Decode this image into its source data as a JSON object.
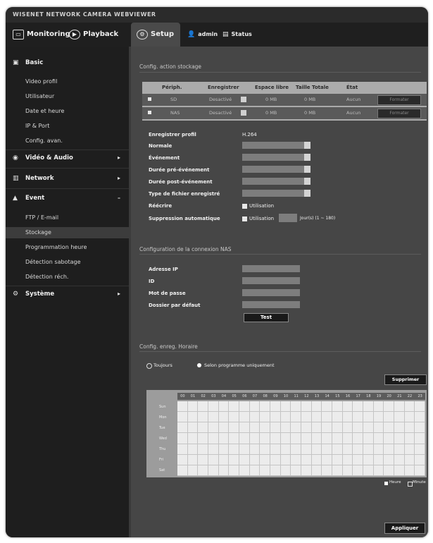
{
  "window": {
    "title": "WISENET NETWORK CAMERA WEBVIEWER"
  },
  "topnav": {
    "monitoring": "Monitoring",
    "playback": "Playback",
    "setup": "Setup",
    "user": "admin",
    "status": "Status"
  },
  "sidebar": {
    "basic": "Basic",
    "basic_items": [
      "Video profil",
      "Utilisateur",
      "Date et heure",
      "IP & Port",
      "Config. avan."
    ],
    "video_audio": "Vidéo & Audio",
    "network": "Network",
    "event": "Event",
    "event_items": [
      "FTP / E-mail",
      "Stockage",
      "Programmation heure",
      "Détection sabotage",
      "Détection réch."
    ],
    "system": "Système"
  },
  "storage": {
    "section_title": "Config. action stockage",
    "columns": [
      "Périph.",
      "Enregistrer",
      "Espace libre",
      "Taille Totale",
      "État"
    ],
    "rows": [
      {
        "device": "SD",
        "record": "Desactivé",
        "free": "0 MB",
        "total": "0 MB",
        "state": "Aucun",
        "action": "Formater"
      },
      {
        "device": "NAS",
        "record": "Desactivé",
        "free": "0 MB",
        "total": "0 MB",
        "state": "Aucun",
        "action": "Formater"
      }
    ]
  },
  "form": {
    "profile_label": "Enregistrer profil",
    "profile_value": "H.264",
    "normal_label": "Normale",
    "event_label": "Événement",
    "pre_event_label": "Durée pré-événement",
    "post_event_label": "Durée post-événement",
    "file_type_label": "Type de fichier enregistré",
    "overwrite_label": "Réécrire",
    "overwrite_check": "Utilisation",
    "auto_delete_label": "Suppression automatique",
    "auto_delete_check": "Utilisation",
    "auto_delete_range": "Jour(s) (1 ~ 180)"
  },
  "nas": {
    "section_title": "Configuration de la connexion NAS",
    "ip_label": "Adresse IP",
    "id_label": "ID",
    "password_label": "Mot de passe",
    "folder_label": "Dossier par défaut",
    "test_button": "Test"
  },
  "schedule": {
    "section_title": "Config. enreg. Horaire",
    "option_always": "Toujours",
    "option_scheduled": "Selon programme uniquement",
    "delete_button": "Supprimer",
    "hours": [
      "00",
      "01",
      "02",
      "03",
      "04",
      "05",
      "06",
      "07",
      "08",
      "09",
      "10",
      "11",
      "12",
      "13",
      "14",
      "15",
      "16",
      "17",
      "18",
      "19",
      "20",
      "21",
      "22",
      "23"
    ],
    "days": [
      "Sun",
      "Mon",
      "Tue",
      "Wed",
      "Thu",
      "Fri",
      "Sat"
    ],
    "legend_hour": "Heure",
    "legend_minute": "Minute"
  },
  "apply_button": "Appliquer"
}
